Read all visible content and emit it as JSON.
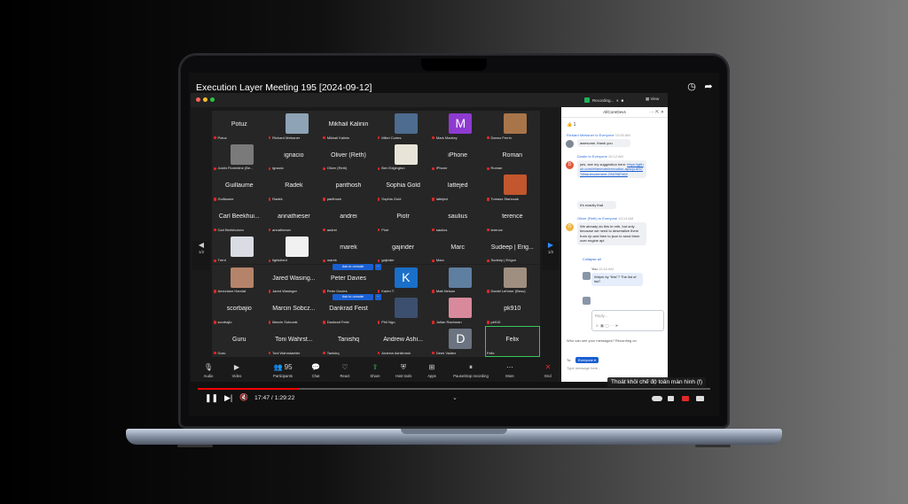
{
  "video": {
    "title": "Execution Layer Meeting 195 [2024-09-12]",
    "current_time": "17:47",
    "duration": "1:29:22",
    "progress_fraction": 0.199,
    "tooltip": "Thoát khỏi chế độ toàn màn hình (f)"
  },
  "zoom": {
    "recording_label": "Recording...",
    "view_label": "View",
    "page_left": "1/2",
    "page_right": "1/2",
    "tiles": [
      {
        "big": "Potuz",
        "small": "Potuz",
        "muted": true
      },
      {
        "big": "",
        "small": "Richard Meissner",
        "muted": true,
        "avatar": "#8ea3b5"
      },
      {
        "big": "Mikhail Kalinin",
        "small": "Mikhail Kalinin",
        "muted": true
      },
      {
        "big": "",
        "small": "Mikel Cortes",
        "muted": true,
        "avatar": "#4d6c8f"
      },
      {
        "big": "",
        "small": "Mark Mackey",
        "muted": true,
        "letter": "M",
        "letter_bg": "#8e3ad1"
      },
      {
        "big": "",
        "small": "Danno Ferrin",
        "muted": true,
        "avatar": "#a8754a"
      },
      {
        "big": "",
        "small": "Justin Florentine (Be...",
        "muted": true,
        "avatar": "#7a7a7a"
      },
      {
        "big": "ignacio",
        "small": "ignacio",
        "muted": true
      },
      {
        "big": "Oliver (Reth)",
        "small": "Oliver (Reth)",
        "muted": true
      },
      {
        "big": "",
        "small": "Ben Edgington",
        "muted": true,
        "avatar": "#e8e4d8"
      },
      {
        "big": "iPhone",
        "small": "iPhone",
        "muted": true
      },
      {
        "big": "Roman",
        "small": "Roman",
        "muted": true
      },
      {
        "big": "Guillaume",
        "small": "Guillaume",
        "muted": true
      },
      {
        "big": "Radek",
        "small": "Radek",
        "muted": true
      },
      {
        "big": "parithosh",
        "small": "parithosh",
        "muted": true
      },
      {
        "big": "Sophia Gold",
        "small": "Sophia Gold",
        "muted": true
      },
      {
        "big": "lattejed",
        "small": "lattejed",
        "muted": true
      },
      {
        "big": "",
        "small": "Tomasz Stańczak",
        "muted": true,
        "avatar": "#c2562c"
      },
      {
        "big": "Carl Beekhui...",
        "small": "Carl Beekhuizen",
        "muted": true
      },
      {
        "big": "annathieser",
        "small": "annathieser",
        "muted": true
      },
      {
        "big": "andrei",
        "small": "andrei",
        "muted": true
      },
      {
        "big": "Piotr",
        "small": "Piotr",
        "muted": true
      },
      {
        "big": "saulius",
        "small": "saulius",
        "muted": true
      },
      {
        "big": "terence",
        "small": "terence",
        "muted": true
      },
      {
        "big": "",
        "small": "Trent",
        "muted": true,
        "avatar": "#d9dde3"
      },
      {
        "big": "",
        "small": "lightclient",
        "muted": true,
        "avatar": "#f1f1f1"
      },
      {
        "big": "marek",
        "small": "marek",
        "muted": true
      },
      {
        "big": "gajinder",
        "small": "gajinder",
        "muted": true
      },
      {
        "big": "Marc",
        "small": "Marc",
        "muted": true
      },
      {
        "big": "Sudeep | Erig...",
        "small": "Sudeep | Erigon",
        "muted": true
      },
      {
        "big": "",
        "small": "Ameziane Hamlat",
        "muted": true,
        "avatar": "#b5836a"
      },
      {
        "big": "Jared Wasing...",
        "small": "Jared Wasinger",
        "muted": true
      },
      {
        "big": "Peter Davies",
        "small": "Peter Davies",
        "muted": true
      },
      {
        "big": "",
        "small": "Karim T.",
        "muted": true,
        "letter": "K",
        "letter_bg": "#1a6fc9"
      },
      {
        "big": "",
        "small": "Matt Nelson",
        "muted": true,
        "avatar": "#5f7fa0"
      },
      {
        "big": "",
        "small": "Daniel Lehrner (Besu)",
        "muted": true,
        "avatar": "#9f8f80"
      },
      {
        "big": "scorbajio",
        "small": "scorbajio",
        "muted": true
      },
      {
        "big": "Marcin Sobcz...",
        "small": "Marcin Sobczak",
        "muted": true
      },
      {
        "big": "Dankrad Feist",
        "small": "Dankrad Feist",
        "muted": true
      },
      {
        "big": "",
        "small": "Phil Ngo",
        "muted": true,
        "avatar": "#3c4f6e"
      },
      {
        "big": "",
        "small": "Julian Rachman",
        "muted": true,
        "avatar": "#d88a9c"
      },
      {
        "big": "pk910",
        "small": "pk910",
        "muted": true
      },
      {
        "big": "Guru",
        "small": "Guru",
        "muted": true
      },
      {
        "big": "Toni Wahrst...",
        "small": "Toni Wahrstaetter",
        "muted": true
      },
      {
        "big": "Tanishq",
        "small": "Tanishq",
        "muted": true
      },
      {
        "big": "Andrew Ashi...",
        "small": "Andrew Ashikhmin",
        "muted": true
      },
      {
        "big": "",
        "small": "Demi Valdez",
        "muted": true,
        "letter": "D",
        "letter_bg": "#6b7480"
      },
      {
        "big": "Felix",
        "small": "Felix",
        "muted": false,
        "active": true
      }
    ],
    "ask_to_unmute": "Ask to unmute",
    "toolbar": [
      {
        "icon": "🎙",
        "label": "Audio"
      },
      {
        "icon": "▶",
        "label": "Video"
      },
      {
        "icon": "👥",
        "label": "Participants",
        "count": "95"
      },
      {
        "icon": "💬",
        "label": "Chat"
      },
      {
        "icon": "♡",
        "label": "React"
      },
      {
        "icon": "⇪",
        "label": "Share"
      },
      {
        "icon": "⛨",
        "label": "Host tools"
      },
      {
        "icon": "⊞",
        "label": "Apps"
      },
      {
        "icon": "⏸",
        "label": "Pause/stop recording"
      },
      {
        "icon": "⋯",
        "label": "More"
      },
      {
        "icon": "✕",
        "label": "End"
      }
    ]
  },
  "chat": {
    "title": "AllCoreDevs",
    "messages": [
      {
        "from": "Richard Meissner to Everyone",
        "time": "10:05 AM",
        "text": "awesome, thank you"
      },
      {
        "from": "Dustin to Everyone",
        "time": "10:12 AM",
        "text_pre": "yes, see my suggestion here:",
        "link": "https://github.com/ethereum/execution-apis/pull/577#issuecomment-2342587462",
        "text2": "it's exactly that"
      },
      {
        "from": "Oliver (Reth) to Everyone",
        "time": "10:14 AM",
        "text": "We already do this in reth, but only because we need to deserialize them from rlp and then to json to send them over engine api"
      },
      {
        "collapse": "Collapse all"
      },
      {
        "from": "You",
        "time": "10:16 AM",
        "text": "Wdym by \"this\"? The list of list?"
      }
    ],
    "reply_placeholder": "Reply...",
    "visibility": "Who can see your messages? Recording on",
    "to_label": "To:",
    "to_value": "Everyone",
    "compose_placeholder": "Type message here..."
  },
  "colors": {
    "accent_blue": "#1a5fd1",
    "muted_red": "#e02828",
    "active_green": "#35c759",
    "yt_red": "#ff0000"
  }
}
